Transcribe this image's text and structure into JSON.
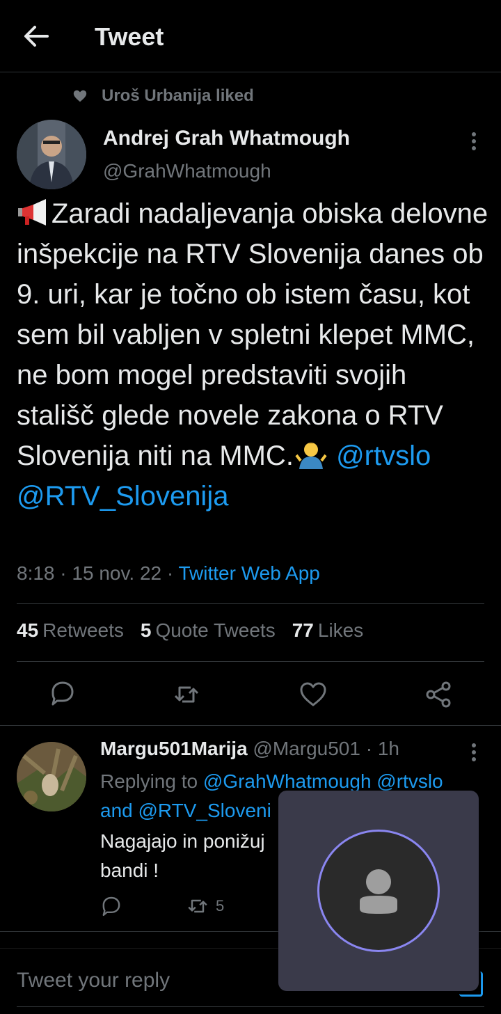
{
  "header": {
    "title": "Tweet",
    "back_icon": "arrow-left-icon"
  },
  "social_context": {
    "text": "Uroš Urbanija liked",
    "icon": "heart-icon"
  },
  "author": {
    "name": "Andrej Grah Whatmough",
    "handle": "@GrahWhatmough"
  },
  "tweet": {
    "emoji_lead": "megaphone-emoji",
    "text_main": "Zaradi nadaljevanja obiska delovne inšpekcije na RTV Slovenija danes ob 9. uri, kar je točno ob istem času, kot sem bil vabljen v spletni klepet MMC, ne bom mogel predstaviti svojih stališč glede novele zakona o RTV Slovenija niti na MMC.",
    "emoji_tail": "person-shrugging-emoji",
    "mention_1": "@rtvslo",
    "mention_2": "@RTV_Slovenija"
  },
  "meta": {
    "time": "8:18",
    "date": "15 nov. 22",
    "separator": "·",
    "source": "Twitter Web App"
  },
  "stats": {
    "retweets_count": "45",
    "retweets_label": "Retweets",
    "quotes_count": "5",
    "quotes_label": "Quote Tweets",
    "likes_count": "77",
    "likes_label": "Likes"
  },
  "actions": [
    "reply-icon",
    "retweet-icon",
    "like-icon",
    "share-icon"
  ],
  "reply": {
    "name": "Margu501Marija",
    "handle": "@Margu501",
    "time": "· 1h",
    "replying_prefix": "Replying to",
    "replying_mention_1": "@GrahWhatmough",
    "replying_mention_2": "@rtvslo",
    "replying_and": "and",
    "replying_mention_3": "@RTV_Sloveni",
    "body_line_1": "Nagajajo in ponižuj",
    "body_line_2": "bandi !",
    "retweet_count": "5"
  },
  "compose": {
    "placeholder": "Tweet your reply"
  },
  "colors": {
    "accent": "#1d9bf0",
    "muted": "#71767b",
    "text": "#e7e9ea",
    "background": "#000000",
    "overlay_ring": "#8a86f0"
  }
}
